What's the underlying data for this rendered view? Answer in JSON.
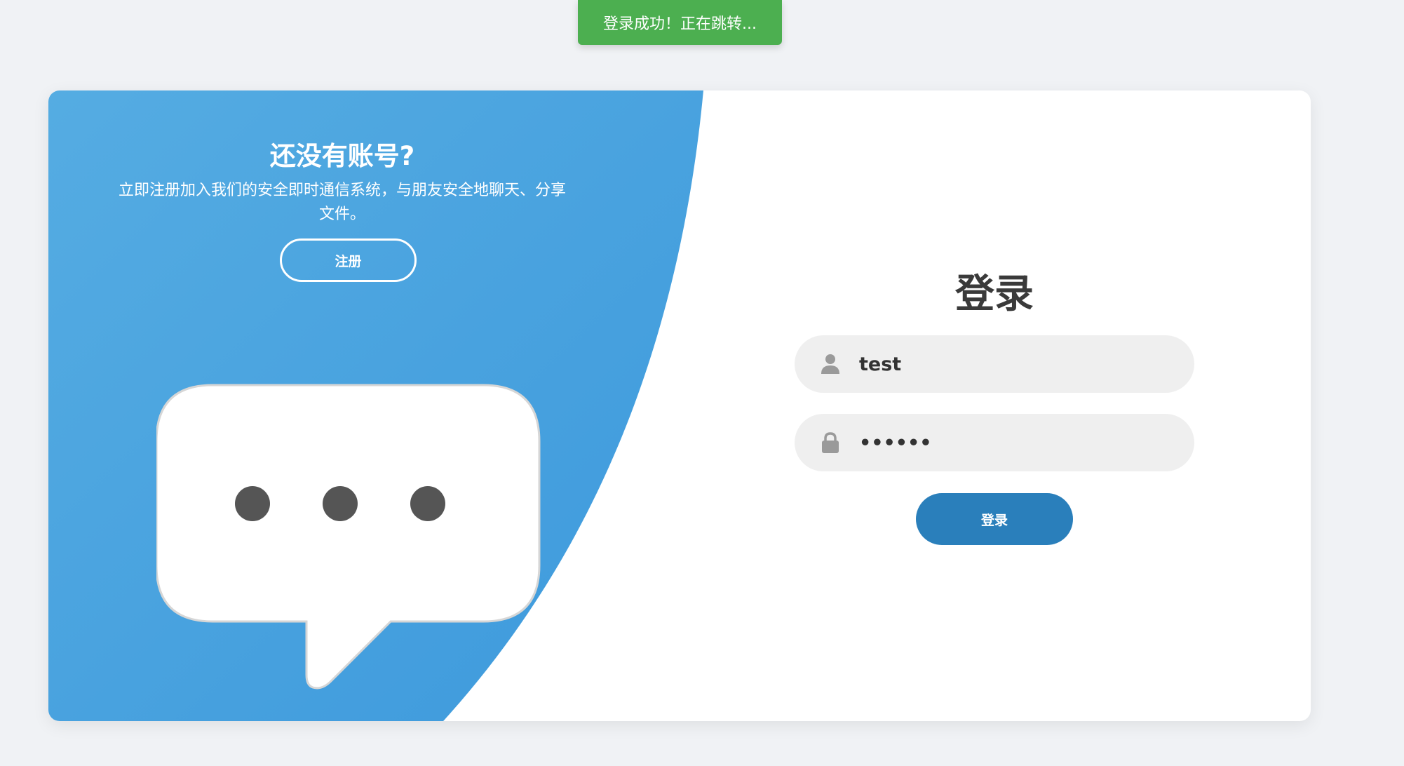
{
  "toast": {
    "message": "登录成功！正在跳转..."
  },
  "left_panel": {
    "title": "还没有账号?",
    "description": "立即注册加入我们的安全即时通信系统，与朋友安全地聊天、分享文件。",
    "register_label": "注册",
    "illustration": "chat-bubble-icon"
  },
  "login_form": {
    "title": "登录",
    "username": {
      "icon": "user-icon",
      "value": "test"
    },
    "password": {
      "icon": "lock-icon",
      "value": "••••••"
    },
    "submit_label": "登录"
  },
  "colors": {
    "page_bg": "#f0f2f5",
    "panel_blue": "#47a2de",
    "button_blue": "#2a7fbb",
    "toast_green": "#4caf50",
    "field_bg": "#efefef"
  }
}
